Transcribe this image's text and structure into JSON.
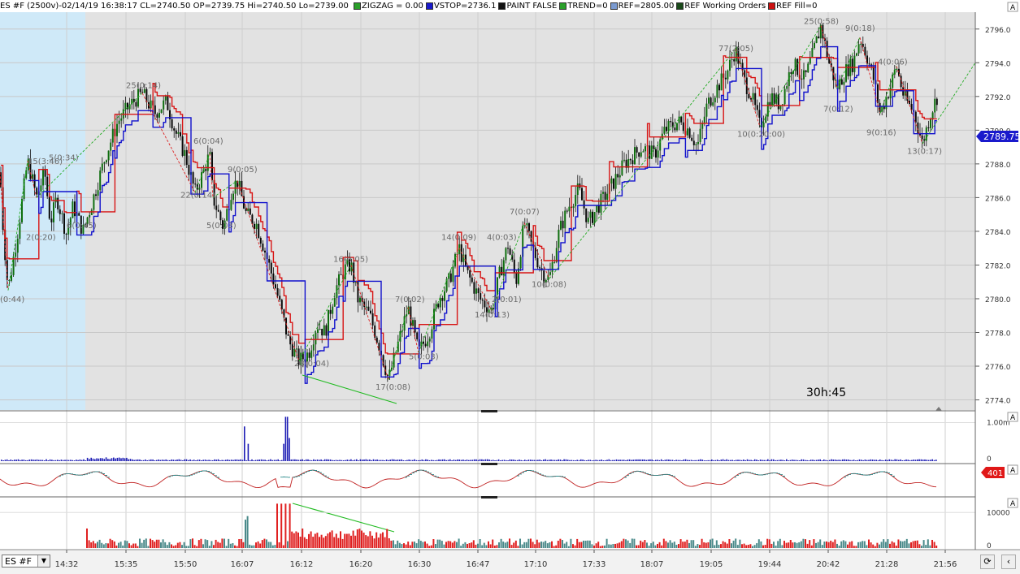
{
  "header": {
    "title": "ES #F (2500v)-02/14/19 16:38:17 CL=2740.50 OP=2739.75 Hi=2740.50 Lo=2739.00",
    "indicators": [
      {
        "label": "ZIGZAG = 0.00",
        "color": "#2aa02a"
      },
      {
        "label": "VSTOP=2736.1",
        "color": "#1a1acc"
      },
      {
        "label": "PAINT FALSE",
        "color": "#111111"
      },
      {
        "label": "TREND=0",
        "color": "#2aa02a"
      },
      {
        "label": "REF=2805.00",
        "color": "#7a9ad0"
      },
      {
        "label": "REF Working Orders",
        "color": "#1a4a1a"
      },
      {
        "label": "REF Fill=0",
        "color": "#cc1111"
      }
    ]
  },
  "symbol_selector": {
    "value": "ES #F"
  },
  "timer_label": "30h:45",
  "last_price_label": "2789.75",
  "osc_value_label": "401",
  "panel_markers": [
    "A",
    "A",
    "A",
    "A"
  ],
  "colors": {
    "up_candle": "#0f6e0f",
    "down_candle": "#0a0a0a",
    "resistance": "#d81515",
    "support": "#1111cc",
    "zigzag_up": "#22aa22",
    "zigzag_down": "#dd2222",
    "session_shade": "#cfe9f8",
    "chart_bg": "#e2e2e2",
    "volume": "#1c1cb4",
    "delta_pos": "#4a8a8a",
    "delta_neg": "#e02020"
  },
  "chart_data": [
    {
      "type": "candlestick",
      "panel": "price",
      "y_ticks": [
        2774.0,
        2776.0,
        2778.0,
        2780.0,
        2782.0,
        2784.0,
        2786.0,
        2788.0,
        2790.0,
        2792.0,
        2794.0,
        2796.0
      ],
      "ylim": [
        2773.4,
        2797.0
      ],
      "x_tick_labels": [
        "14:32",
        "15:35",
        "15:50",
        "16:07",
        "16:12",
        "16:20",
        "16:30",
        "16:47",
        "17:10",
        "17:33",
        "18:07",
        "19:05",
        "19:44",
        "20:42",
        "21:28",
        "21:56"
      ],
      "price_path": [
        [
          0,
          2787.5
        ],
        [
          4,
          2784.0
        ],
        [
          10,
          2780.5
        ],
        [
          22,
          2784.0
        ],
        [
          34,
          2788.2
        ],
        [
          45,
          2786.0
        ],
        [
          55,
          2787.5
        ],
        [
          62,
          2784.5
        ],
        [
          70,
          2786.0
        ],
        [
          82,
          2783.8
        ],
        [
          90,
          2785.5
        ],
        [
          102,
          2784.0
        ],
        [
          112,
          2785.5
        ],
        [
          130,
          2788.5
        ],
        [
          145,
          2790.5
        ],
        [
          160,
          2791.5
        ],
        [
          175,
          2792.2
        ],
        [
          190,
          2791.0
        ],
        [
          205,
          2791.7
        ],
        [
          215,
          2790.0
        ],
        [
          228,
          2788.5
        ],
        [
          240,
          2786.3
        ],
        [
          250,
          2787.5
        ],
        [
          258,
          2788.6
        ],
        [
          262,
          2786.0
        ],
        [
          275,
          2784.2
        ],
        [
          285,
          2786.5
        ],
        [
          292,
          2787.0
        ],
        [
          303,
          2785.0
        ],
        [
          315,
          2784.5
        ],
        [
          325,
          2783.0
        ],
        [
          340,
          2780.5
        ],
        [
          355,
          2777.5
        ],
        [
          368,
          2776.3
        ],
        [
          380,
          2776.8
        ],
        [
          390,
          2778.5
        ],
        [
          400,
          2778.0
        ],
        [
          412,
          2780.5
        ],
        [
          425,
          2781.8
        ],
        [
          432,
          2782.0
        ],
        [
          440,
          2780.0
        ],
        [
          455,
          2779.0
        ],
        [
          468,
          2777.0
        ],
        [
          478,
          2775.2
        ],
        [
          488,
          2777.0
        ],
        [
          502,
          2779.5
        ],
        [
          515,
          2776.8
        ],
        [
          528,
          2778.0
        ],
        [
          540,
          2780.0
        ],
        [
          552,
          2781.0
        ],
        [
          565,
          2783.0
        ],
        [
          575,
          2781.5
        ],
        [
          590,
          2780.0
        ],
        [
          605,
          2779.3
        ],
        [
          615,
          2781.5
        ],
        [
          625,
          2783.2
        ],
        [
          635,
          2781.0
        ],
        [
          645,
          2784.5
        ],
        [
          655,
          2783.0
        ],
        [
          668,
          2781.5
        ],
        [
          676,
          2781.2
        ],
        [
          688,
          2784.0
        ],
        [
          700,
          2785.5
        ],
        [
          712,
          2786.5
        ],
        [
          724,
          2784.5
        ],
        [
          736,
          2785.5
        ],
        [
          750,
          2786.5
        ],
        [
          768,
          2788.0
        ],
        [
          790,
          2789.0
        ],
        [
          805,
          2788.5
        ],
        [
          818,
          2790.0
        ],
        [
          835,
          2790.5
        ],
        [
          848,
          2790.0
        ],
        [
          858,
          2789.0
        ],
        [
          870,
          2791.5
        ],
        [
          882,
          2792.5
        ],
        [
          895,
          2793.5
        ],
        [
          905,
          2794.8
        ],
        [
          915,
          2793.0
        ],
        [
          925,
          2792.0
        ],
        [
          935,
          2790.2
        ],
        [
          948,
          2792.0
        ],
        [
          960,
          2791.5
        ],
        [
          975,
          2794.0
        ],
        [
          990,
          2793.0
        ],
        [
          1000,
          2794.5
        ],
        [
          1010,
          2796.2
        ],
        [
          1020,
          2794.0
        ],
        [
          1030,
          2792.5
        ],
        [
          1040,
          2793.5
        ],
        [
          1050,
          2794.0
        ],
        [
          1058,
          2795.5
        ],
        [
          1066,
          2794.5
        ],
        [
          1075,
          2793.0
        ],
        [
          1083,
          2791.0
        ],
        [
          1095,
          2792.5
        ],
        [
          1103,
          2793.8
        ],
        [
          1112,
          2792.0
        ],
        [
          1125,
          2791.0
        ],
        [
          1135,
          2789.2
        ],
        [
          1145,
          2791.0
        ],
        [
          1153,
          2792.0
        ]
      ],
      "zigzag_labels": [
        {
          "text": "(0:44)",
          "x": 0,
          "y": 2779.8
        },
        {
          "text": "15(3:46)",
          "x": 34,
          "y": 2788.0
        },
        {
          "text": "5(0:34)",
          "x": 60,
          "y": 2788.2
        },
        {
          "text": "2(0:20)",
          "x": 32,
          "y": 2783.5
        },
        {
          "text": "6(0:45)",
          "x": 82,
          "y": 2784.2
        },
        {
          "text": "25(0:14)",
          "x": 155,
          "y": 2792.5
        },
        {
          "text": "6(0:04)",
          "x": 238,
          "y": 2789.2
        },
        {
          "text": "22(0:14)",
          "x": 222,
          "y": 2786.0
        },
        {
          "text": "9(0:05)",
          "x": 280,
          "y": 2787.5
        },
        {
          "text": "5(0:03)",
          "x": 254,
          "y": 2784.2
        },
        {
          "text": "16(0:05)",
          "x": 410,
          "y": 2782.2
        },
        {
          "text": "28(0:04)",
          "x": 362,
          "y": 2776.0
        },
        {
          "text": "7(0:02)",
          "x": 486,
          "y": 2779.8
        },
        {
          "text": "17(0:08)",
          "x": 462,
          "y": 2774.6
        },
        {
          "text": "5(0:03)",
          "x": 503,
          "y": 2776.4
        },
        {
          "text": "14(0:09)",
          "x": 543,
          "y": 2783.5
        },
        {
          "text": "4(0:03)",
          "x": 599,
          "y": 2783.5
        },
        {
          "text": "7(0:07)",
          "x": 627,
          "y": 2785.0
        },
        {
          "text": "2(0:01)",
          "x": 605,
          "y": 2779.8
        },
        {
          "text": "14(0:13)",
          "x": 584,
          "y": 2778.9
        },
        {
          "text": "10(0:08)",
          "x": 654,
          "y": 2780.7
        },
        {
          "text": "77(2:05)",
          "x": 884,
          "y": 2794.7
        },
        {
          "text": "10(0:20:00)",
          "x": 907,
          "y": 2789.6
        },
        {
          "text": "25(0:58)",
          "x": 989,
          "y": 2796.3
        },
        {
          "text": "9(0:18)",
          "x": 1040,
          "y": 2795.9
        },
        {
          "text": "4(0:06)",
          "x": 1080,
          "y": 2793.9
        },
        {
          "text": "7(0:12)",
          "x": 1013,
          "y": 2791.1
        },
        {
          "text": "9(0:16)",
          "x": 1066,
          "y": 2789.7
        },
        {
          "text": "13(0:17)",
          "x": 1116,
          "y": 2788.6
        }
      ]
    },
    {
      "type": "bar",
      "panel": "volume",
      "y_tick_labels": [
        "1.00m",
        "0"
      ],
      "spikes": [
        {
          "x": 300,
          "value": 0.9
        },
        {
          "x": 304,
          "value": 0.45
        },
        {
          "x": 348,
          "value": 0.45
        },
        {
          "x": 352,
          "value": 1.15
        },
        {
          "x": 356,
          "value": 0.6
        }
      ]
    },
    {
      "type": "line",
      "panel": "oscillator",
      "current_value": 401
    },
    {
      "type": "bar",
      "panel": "delta",
      "y_tick_labels": [
        "10000",
        "0"
      ],
      "spikes": [
        {
          "x": 106,
          "value": 5500
        },
        {
          "x": 300,
          "value": 8000
        },
        {
          "x": 304,
          "value": 9000
        },
        {
          "x": 340,
          "value": 12500
        },
        {
          "x": 345,
          "value": 12500
        },
        {
          "x": 350,
          "value": 12500
        },
        {
          "x": 355,
          "value": 12500
        }
      ]
    }
  ]
}
